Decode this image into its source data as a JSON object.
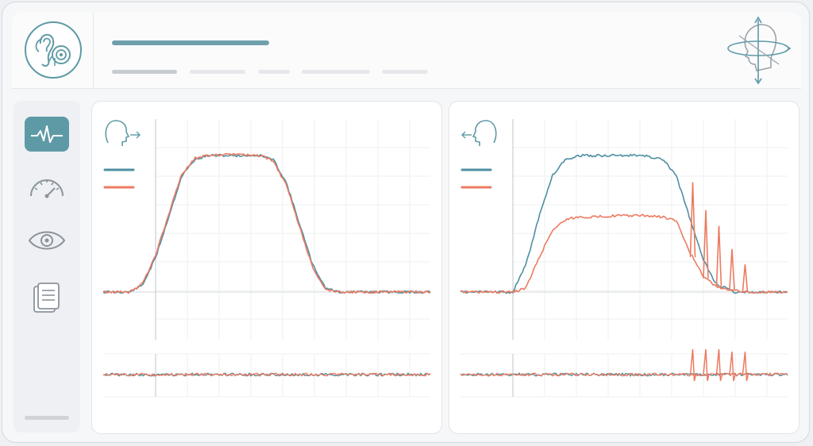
{
  "colors": {
    "accent": "#5e9aa6",
    "series_teal": "#4e8fa2",
    "series_orange": "#ec7b61",
    "placeholder_dark": "#6fa0ac",
    "placeholder_grey": "#c8ccd1",
    "placeholder_light": "#e6e8eb"
  },
  "header": {
    "logo_icon": "inner-ear-icon",
    "profile_icon": "head-rotation-icon"
  },
  "sidebar": {
    "items": [
      {
        "icon": "waveform-icon",
        "active": true
      },
      {
        "icon": "gauge-icon",
        "active": false
      },
      {
        "icon": "eye-icon",
        "active": false
      },
      {
        "icon": "document-icon",
        "active": false
      }
    ]
  },
  "chart_data": [
    {
      "type": "line",
      "panel": "left",
      "direction_icon": "head-turn-right-icon",
      "legend_placement": "top-left",
      "grid": true,
      "main": {
        "x": [
          0,
          8,
          12,
          16,
          20,
          24,
          28,
          32,
          40,
          48,
          52,
          56,
          60,
          64,
          68,
          72,
          80,
          100
        ],
        "series": [
          {
            "color": "#4e8fa2",
            "values": [
              0,
              0,
              0.05,
              0.25,
              0.55,
              0.85,
              0.97,
              1,
              1,
              1,
              0.97,
              0.8,
              0.5,
              0.2,
              0.03,
              0,
              0,
              0
            ]
          },
          {
            "color": "#ec7b61",
            "values": [
              0,
              0,
              0.06,
              0.27,
              0.57,
              0.86,
              0.98,
              1,
              1.01,
              1,
              0.96,
              0.78,
              0.48,
              0.18,
              0.02,
              0,
              0,
              0
            ]
          }
        ]
      },
      "sub": {
        "x": [
          0,
          100
        ],
        "series": [
          {
            "color": "#4e8fa2",
            "values": [
              0,
              0
            ]
          },
          {
            "color": "#ec7b61",
            "values": [
              0,
              0
            ]
          }
        ]
      }
    },
    {
      "type": "line",
      "panel": "right",
      "direction_icon": "head-turn-left-icon",
      "legend_placement": "top-left",
      "grid": true,
      "main": {
        "x": [
          0,
          16,
          20,
          24,
          28,
          32,
          36,
          40,
          48,
          56,
          62,
          66,
          70,
          74,
          78,
          84,
          88,
          100
        ],
        "series": [
          {
            "color": "#4e8fa2",
            "values": [
              0,
              0,
              0.2,
              0.55,
              0.85,
              0.97,
              1,
              1,
              1,
              1,
              0.97,
              0.85,
              0.55,
              0.25,
              0.06,
              0,
              0,
              0
            ]
          },
          {
            "color": "#ec7b61",
            "values": [
              0,
              0,
              0.03,
              0.25,
              0.45,
              0.53,
              0.55,
              0.55,
              0.56,
              0.56,
              0.55,
              0.52,
              0.3,
              0.12,
              0.04,
              0.01,
              0,
              0
            ]
          }
        ],
        "spikes": {
          "color": "#ec7b61",
          "x": [
            71,
            75,
            79,
            83,
            87
          ],
          "heights": [
            0.55,
            0.5,
            0.45,
            0.3,
            0.2
          ]
        }
      },
      "sub": {
        "x": [
          0,
          100
        ],
        "series": [
          {
            "color": "#4e8fa2",
            "values": [
              0,
              0
            ]
          },
          {
            "color": "#ec7b61",
            "values": [
              0,
              0
            ]
          }
        ],
        "spikes": {
          "color": "#ec7b61",
          "x": [
            71,
            75,
            79,
            83,
            87
          ],
          "heights": [
            1,
            1,
            1,
            0.9,
            0.9
          ]
        }
      }
    }
  ]
}
